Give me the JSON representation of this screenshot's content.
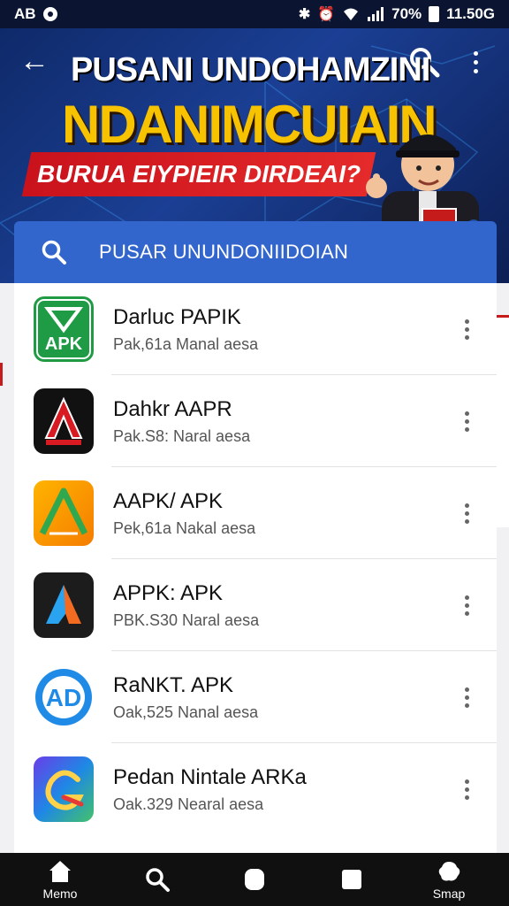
{
  "status_bar": {
    "left_text": "AB",
    "battery_pct": "70%",
    "time": "11.50G"
  },
  "banner": {
    "title": "PUSANI UNDOHAMZINI",
    "subtitle": "NDANIMCUIAIN",
    "ribbon": "BURUA EIYPIEIR DIRDEAI?"
  },
  "search": {
    "placeholder": "PUSAR UNUNDONIIDOIAN"
  },
  "apps": [
    {
      "title": "Darluc PAPIK",
      "subtitle": "Pak,61a Manal aesa",
      "icon": "green-apk-icon",
      "badge": "APK"
    },
    {
      "title": "Dahkr AAPR",
      "subtitle": "Pak.S8: Naral aesa",
      "icon": "red-a-icon"
    },
    {
      "title": "AAPK/ APK",
      "subtitle": "Pek,61a Nakal aesa",
      "icon": "orange-a-icon"
    },
    {
      "title": "APPK: APK",
      "subtitle": "PBK.S30 Naral aesa",
      "icon": "dark-a-icon"
    },
    {
      "title": "RaNKT. APK",
      "subtitle": "Oak,525 Nanal aesa",
      "icon": "blue-ad-icon",
      "badge": "AD"
    },
    {
      "title": "Pedan Nintale ARKa",
      "subtitle": "Oak.329 Nearal aesa",
      "icon": "gradient-g-icon"
    }
  ],
  "bottom_nav": [
    {
      "label": "Memo",
      "icon": "home-icon"
    },
    {
      "label": "",
      "icon": "search-icon"
    },
    {
      "label": "",
      "icon": "circle-icon"
    },
    {
      "label": "",
      "icon": "square-icon"
    },
    {
      "label": "Smap",
      "icon": "blob-icon"
    }
  ]
}
